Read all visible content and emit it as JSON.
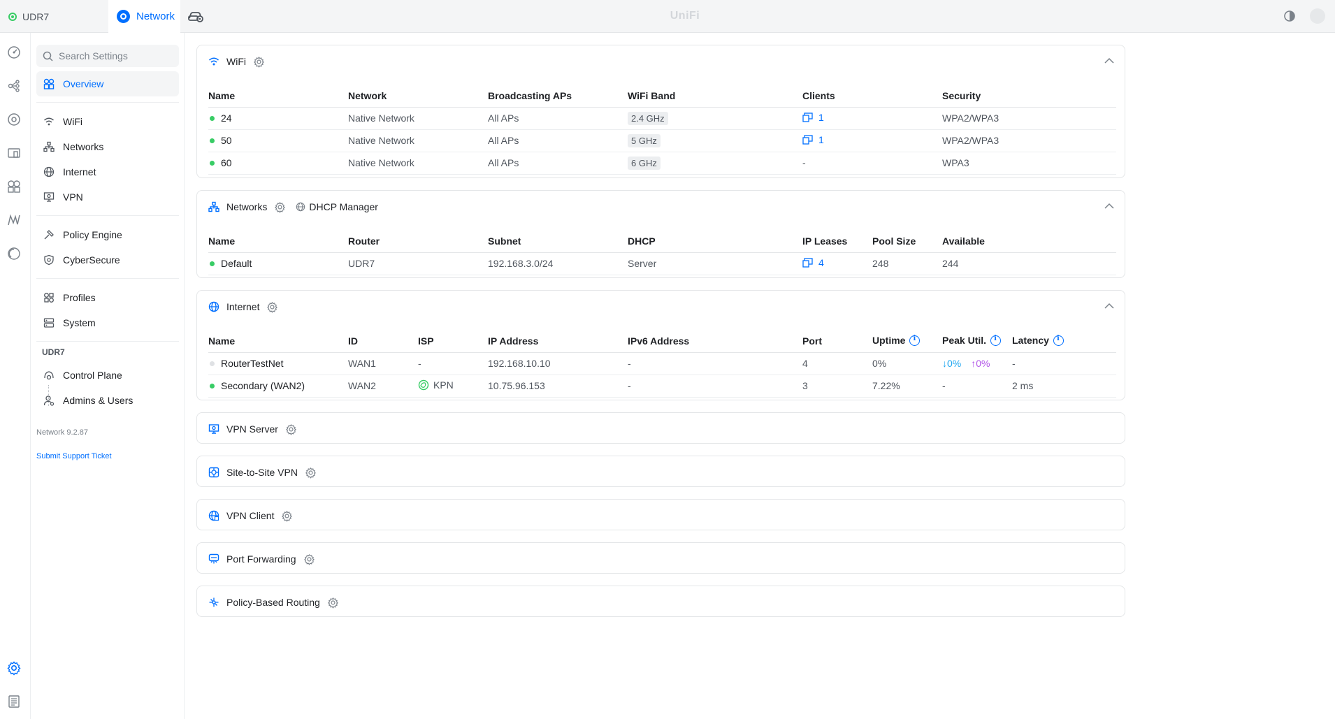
{
  "topbar": {
    "device_tab": "UDR7",
    "network_tab": "Network",
    "brand": "UniFi"
  },
  "nav": {
    "search_placeholder": "Search Settings",
    "overview": "Overview",
    "items": [
      {
        "label": "WiFi"
      },
      {
        "label": "Networks"
      },
      {
        "label": "Internet"
      },
      {
        "label": "VPN"
      },
      {
        "label": "Policy Engine"
      },
      {
        "label": "CyberSecure"
      },
      {
        "label": "Profiles"
      },
      {
        "label": "System"
      }
    ],
    "device_heading": "UDR7",
    "device_items": [
      {
        "label": "Control Plane"
      },
      {
        "label": "Admins & Users"
      }
    ],
    "version": "Network 9.2.87",
    "support": "Submit Support Ticket"
  },
  "wifi": {
    "title": "WiFi",
    "columns": [
      "Name",
      "Network",
      "Broadcasting APs",
      "WiFi Band",
      "Clients",
      "Security"
    ],
    "rows": [
      {
        "name": "24",
        "network": "Native Network",
        "aps": "All APs",
        "band": "2.4 GHz",
        "clients": "1",
        "security": "WPA2/WPA3"
      },
      {
        "name": "50",
        "network": "Native Network",
        "aps": "All APs",
        "band": "5 GHz",
        "clients": "1",
        "security": "WPA2/WPA3"
      },
      {
        "name": "60",
        "network": "Native Network",
        "aps": "All APs",
        "band": "6 GHz",
        "clients": "-",
        "security": "WPA3"
      }
    ]
  },
  "networks": {
    "title": "Networks",
    "dhcp_manager": "DHCP Manager",
    "columns": [
      "Name",
      "Router",
      "Subnet",
      "DHCP",
      "IP Leases",
      "Pool Size",
      "Available"
    ],
    "rows": [
      {
        "name": "Default",
        "router": "UDR7",
        "subnet": "192.168.3.0/24",
        "dhcp": "Server",
        "leases": "4",
        "pool": "248",
        "available": "244"
      }
    ]
  },
  "internet": {
    "title": "Internet",
    "columns": [
      "Name",
      "ID",
      "ISP",
      "IP Address",
      "IPv6 Address",
      "Port",
      "Uptime",
      "Peak Util.",
      "Latency"
    ],
    "rows": [
      {
        "name": "RouterTestNet",
        "id": "WAN1",
        "isp": "-",
        "ip": "192.168.10.10",
        "ipv6": "-",
        "port": "4",
        "uptime": "0%",
        "peak_down": "↓0%",
        "peak_up": "↑0%",
        "latency": "-",
        "status": "offline"
      },
      {
        "name": "Secondary (WAN2)",
        "id": "WAN2",
        "isp": "KPN",
        "ip": "10.75.96.153",
        "ipv6": "-",
        "port": "3",
        "uptime": "7.22%",
        "peak": "-",
        "latency": "2 ms",
        "status": "online"
      }
    ]
  },
  "sections": [
    {
      "title": "VPN Server"
    },
    {
      "title": "Site-to-Site VPN"
    },
    {
      "title": "VPN Client"
    },
    {
      "title": "Port Forwarding"
    },
    {
      "title": "Policy-Based Routing"
    }
  ],
  "colors": {
    "accent": "#006fff",
    "online": "#38cc65",
    "offline": "#dfe1e4",
    "download": "#1ea6f0",
    "upload": "#b256e8"
  }
}
